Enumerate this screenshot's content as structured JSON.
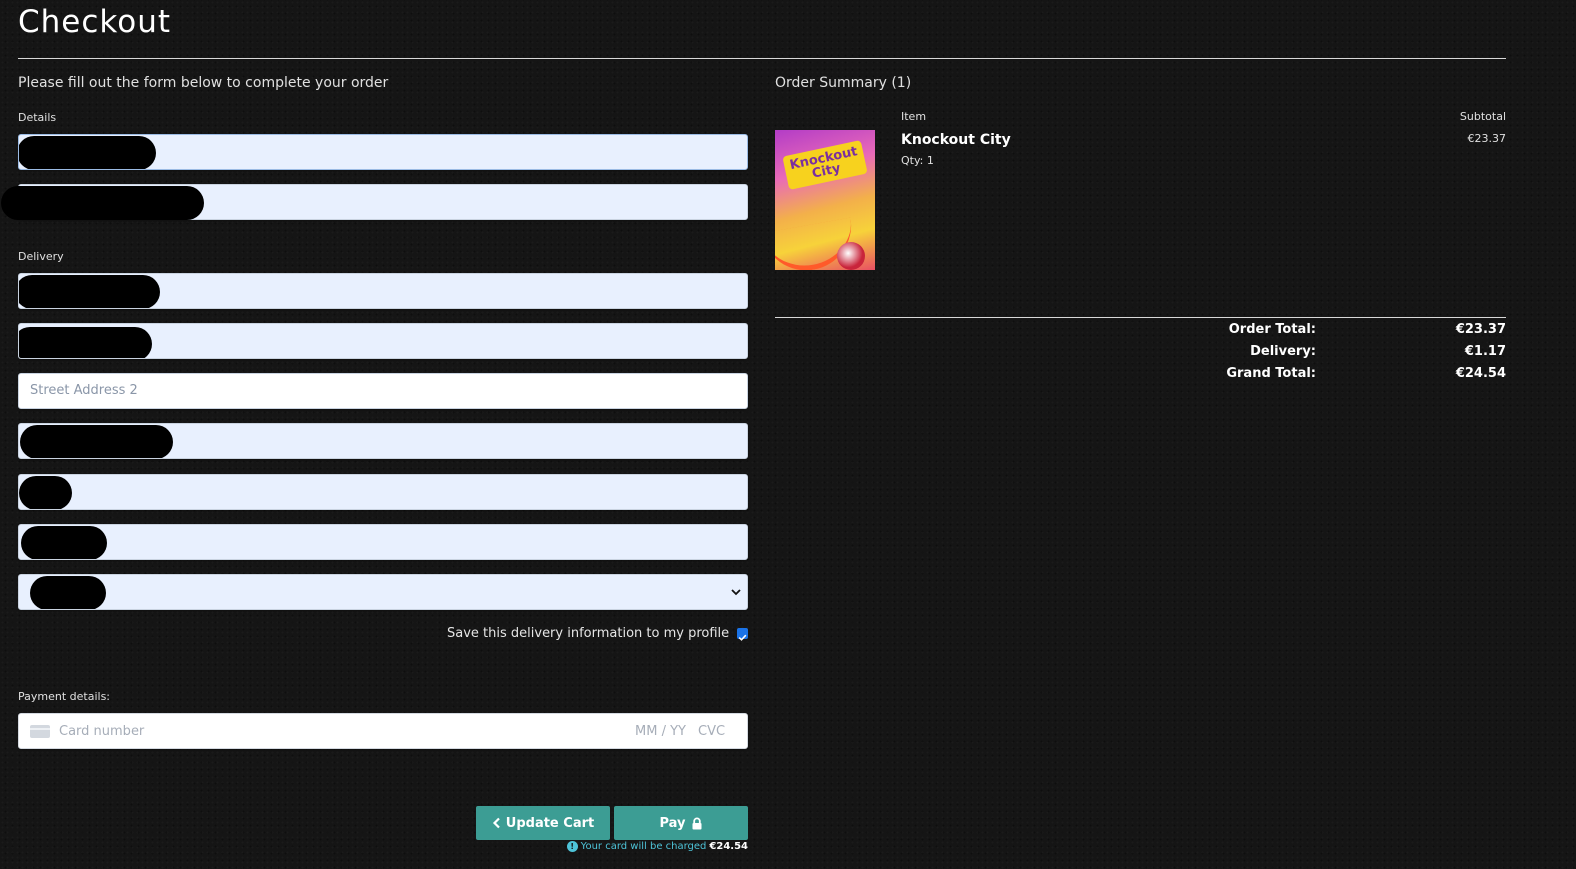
{
  "page": {
    "title": "Checkout",
    "intro": "Please fill out the form below to complete your order"
  },
  "form": {
    "details_label": "Details",
    "delivery_label": "Delivery",
    "street_address_2_placeholder": "Street Address 2",
    "save_delivery_label": "Save this delivery information to my profile",
    "save_delivery_checked": true,
    "payment_label": "Payment details:",
    "card": {
      "number_placeholder": "Card number",
      "expiry_placeholder": "MM / YY",
      "cvc_placeholder": "CVC"
    }
  },
  "actions": {
    "update_cart_label": "Update Cart",
    "pay_label": "Pay",
    "charge_note": "Your card will be charged",
    "charge_amount": "€24.54"
  },
  "summary": {
    "title": "Order Summary (1)",
    "col_item": "Item",
    "col_subtotal": "Subtotal",
    "items": [
      {
        "name": "Knockout City",
        "qty": "Qty: 1",
        "subtotal": "€23.37",
        "cover_text": "Knockout City"
      }
    ],
    "totals": {
      "order_total_label": "Order Total:",
      "order_total": "€23.37",
      "delivery_label": "Delivery:",
      "delivery": "€1.17",
      "grand_total_label": "Grand Total:",
      "grand_total": "€24.54"
    }
  },
  "colors": {
    "accent_button": "#3c9d94",
    "autofill_field": "#e8f0fe",
    "info_text": "#4ec3d8"
  }
}
